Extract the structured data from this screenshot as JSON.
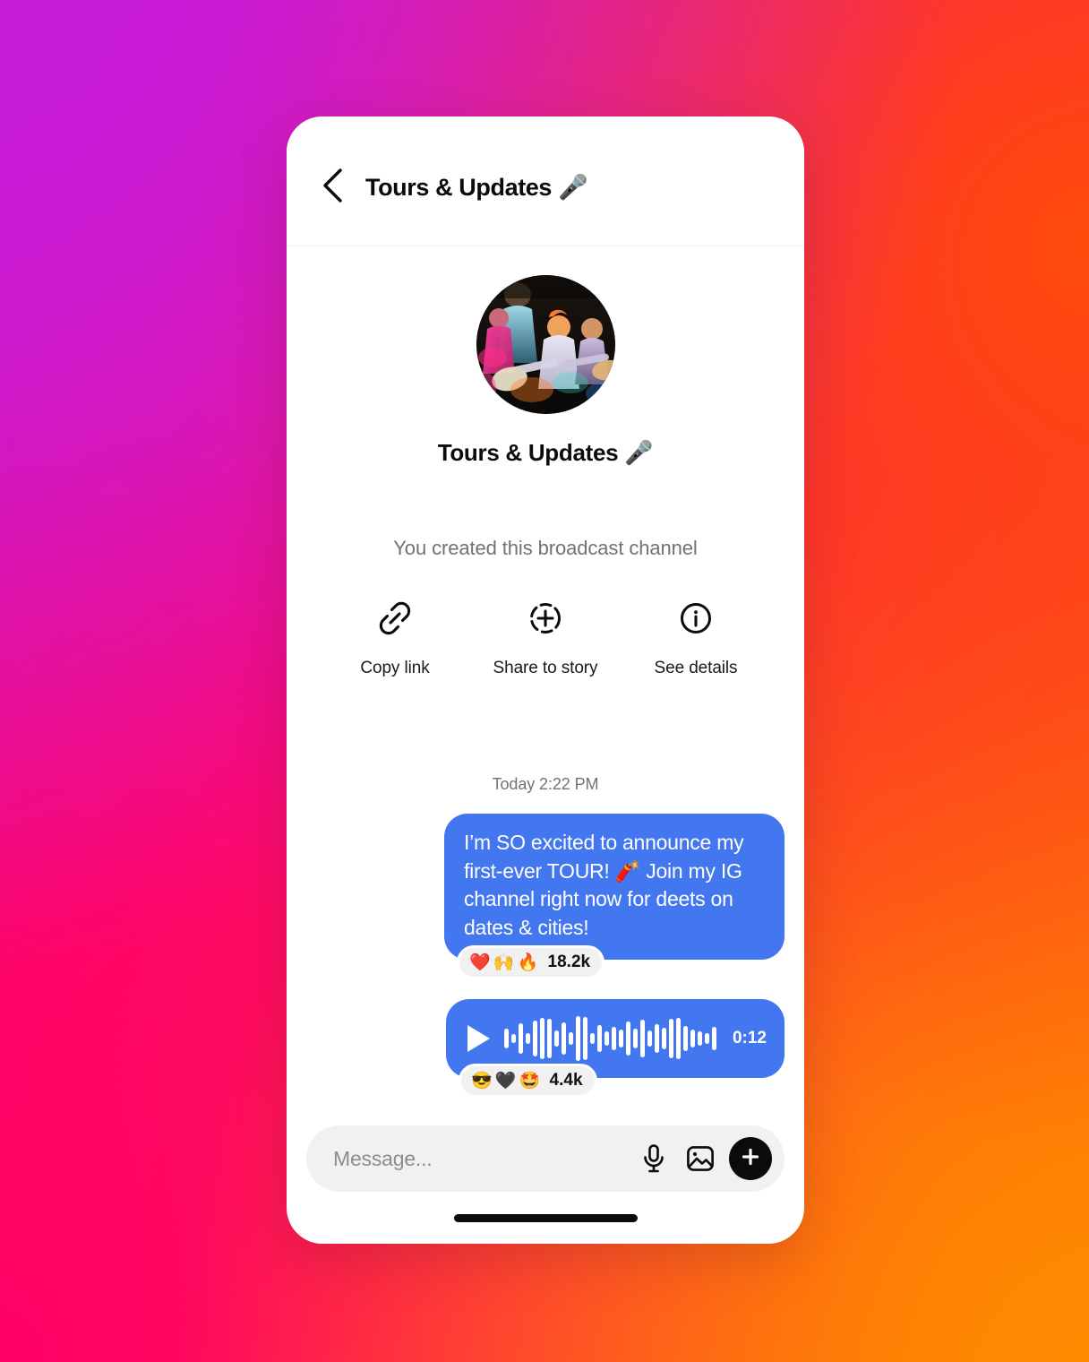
{
  "background": {
    "gradient_colors": [
      "#C81BDC",
      "#FF0B6B",
      "#FF2E38",
      "#FF7A00"
    ]
  },
  "header": {
    "back_icon": "chevron-left-icon",
    "title": "Tours & Updates 🎤"
  },
  "intro": {
    "avatar_alt": "band-performing-on-stage",
    "channel_name": "Tours & Updates 🎤",
    "created_note": "You created this broadcast channel",
    "actions": [
      {
        "icon": "link-icon",
        "label": "Copy link"
      },
      {
        "icon": "add-to-story-icon",
        "label": "Share to story"
      },
      {
        "icon": "info-circle-icon",
        "label": "See details"
      }
    ]
  },
  "thread": {
    "daystamp": "Today 2:22 PM",
    "bubble_color": "#4277F0",
    "messages": [
      {
        "type": "text",
        "text": "I’m SO excited to announce my first-ever TOUR! 🧨 Join my IG channel right now for deets on dates & cities!",
        "reactions": {
          "emojis": "❤️ 🙌 🔥",
          "count": "18.2k"
        }
      },
      {
        "type": "voice",
        "duration": "0:12",
        "play_icon": "play-icon",
        "waveform": [
          22,
          10,
          34,
          12,
          40,
          46,
          44,
          18,
          36,
          14,
          50,
          48,
          12,
          30,
          16,
          26,
          20,
          38,
          22,
          42,
          18,
          32,
          24,
          44,
          46,
          28,
          20,
          16,
          12,
          26
        ],
        "reactions": {
          "emojis": "😎 🖤 🤩",
          "count": "4.4k"
        }
      }
    ]
  },
  "composer": {
    "placeholder": "Message...",
    "value": "",
    "mic_icon": "microphone-icon",
    "photo_icon": "photo-icon",
    "plus_icon": "plus-icon"
  }
}
